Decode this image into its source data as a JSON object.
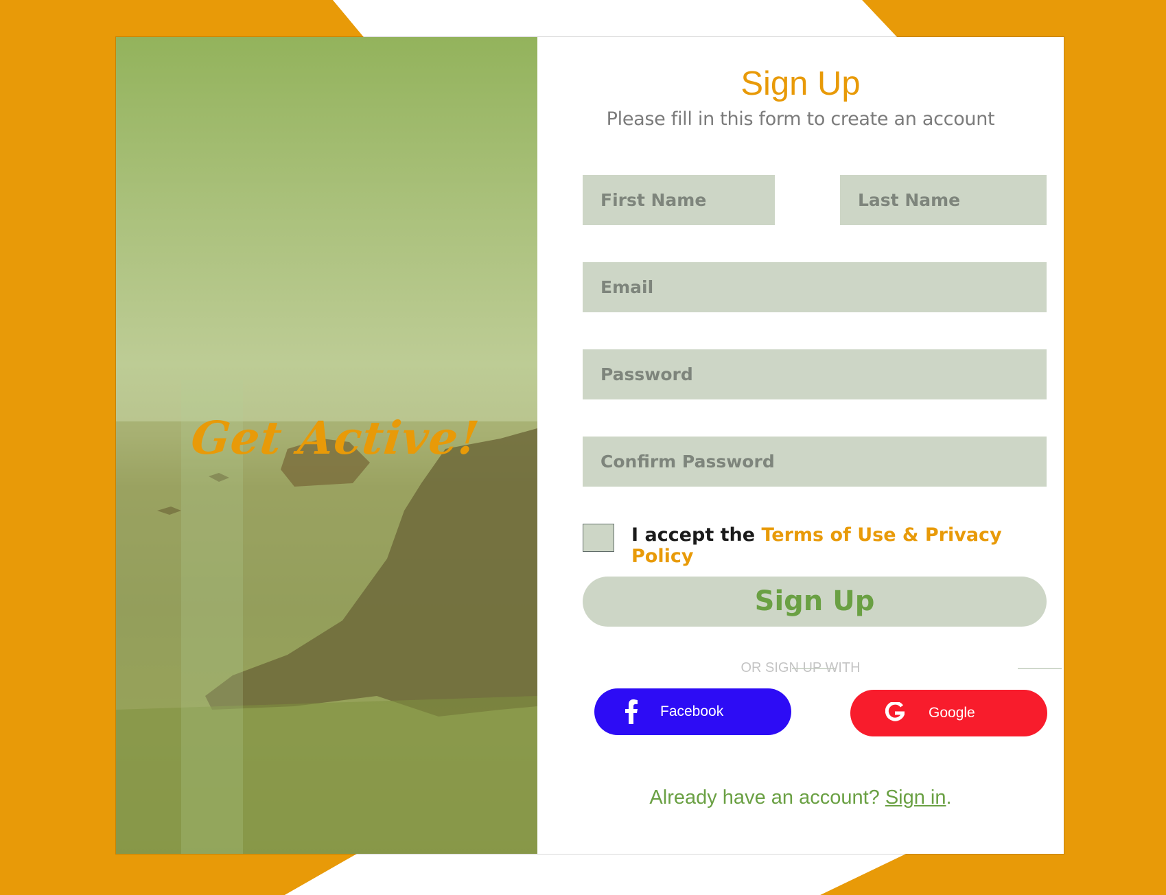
{
  "colors": {
    "accent": "#e89a08",
    "field_bg": "#cdd6c6",
    "green": "#6aa043",
    "facebook": "#2d0cf5",
    "google": "#f81c2c"
  },
  "hero": {
    "text": "Get Active!"
  },
  "form": {
    "title": "Sign Up",
    "subtitle": "Please fill in this form to create an account",
    "first_name_placeholder": "First Name",
    "last_name_placeholder": "Last Name",
    "email_placeholder": "Email",
    "password_placeholder": "Password",
    "confirm_password_placeholder": "Confirm Password",
    "terms_checked": false,
    "accept_prefix": "I accept the",
    "terms_link": "Terms of Use & Privacy Policy",
    "submit_label": "Sign Up",
    "or_text": "OR SIGN UP WITH",
    "facebook_label": "Facebook",
    "google_label": "Google",
    "already_text": "Already have an account?",
    "signin_link": "Sign in",
    "period": "."
  },
  "icons": [
    "facebook-icon",
    "google-icon"
  ]
}
